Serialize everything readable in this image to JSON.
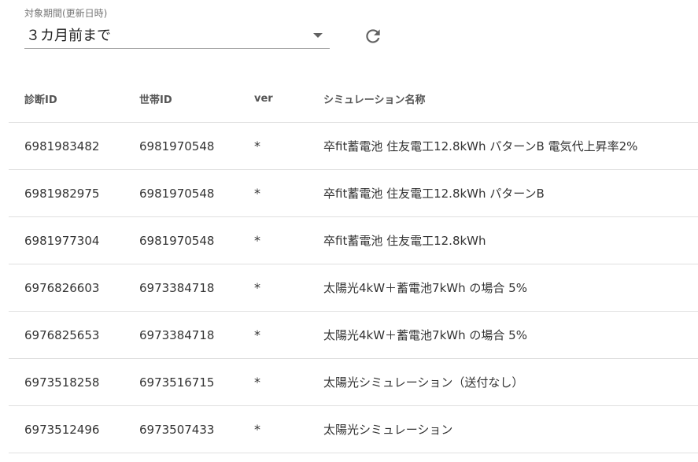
{
  "filter": {
    "label": "対象期間(更新日時)",
    "selected": "３カ月前まで"
  },
  "table": {
    "headers": [
      "診断ID",
      "世帯ID",
      "ver",
      "シミュレーション名称"
    ],
    "rows": [
      [
        "6981983482",
        "6981970548",
        "*",
        "卒fit蓄電池 住友電工12.8kWh パターンB 電気代上昇率2%"
      ],
      [
        "6981982975",
        "6981970548",
        "*",
        "卒fit蓄電池 住友電工12.8kWh パターンB"
      ],
      [
        "6981977304",
        "6981970548",
        "*",
        "卒fit蓄電池 住友電工12.8kWh"
      ],
      [
        "6976826603",
        "6973384718",
        "*",
        "太陽光4kW＋蓄電池7kWh の場合 5%"
      ],
      [
        "6976825653",
        "6973384718",
        "*",
        "太陽光4kW＋蓄電池7kWh の場合 5%"
      ],
      [
        "6973518258",
        "6973516715",
        "*",
        "太陽光シミュレーション（送付なし）"
      ],
      [
        "6973512496",
        "6973507433",
        "*",
        "太陽光シミュレーション"
      ]
    ]
  },
  "icons": {
    "refresh": "refresh-icon",
    "dropdown": "chevron-down-icon"
  },
  "colors": {
    "text": "#212121",
    "label": "#757575",
    "divider": "#e0e0e0",
    "icon": "#616161"
  }
}
